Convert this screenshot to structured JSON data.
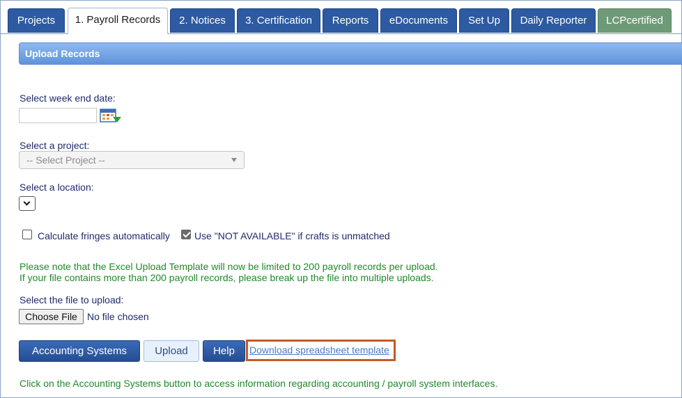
{
  "tabs": [
    {
      "label": "Projects"
    },
    {
      "label": "1. Payroll Records",
      "active": true
    },
    {
      "label": "2. Notices"
    },
    {
      "label": "3. Certification"
    },
    {
      "label": "Reports"
    },
    {
      "label": "eDocuments"
    },
    {
      "label": "Set Up"
    },
    {
      "label": "Daily Reporter"
    },
    {
      "label": "LCPcertified"
    }
  ],
  "panel": {
    "title": "Upload Records"
  },
  "form": {
    "week_end_label": "Select week end date:",
    "week_end_value": "",
    "project_label": "Select a project:",
    "project_selected": "-- Select Project --",
    "location_label": "Select a location:",
    "location_selected": "",
    "calc_fringes": {
      "label": "Calculate fringes automatically",
      "checked": false
    },
    "not_available": {
      "label": "Use \"NOT AVAILABLE\" if crafts is unmatched",
      "checked": true
    },
    "notice_line1": "Please note that the Excel Upload Template will now be limited to 200 payroll records per upload.",
    "notice_line2": "If your file contains more than 200 payroll records, please break up the file into multiple uploads.",
    "file_label": "Select the file to upload:",
    "choose_file": "Choose File",
    "file_status": "No file chosen"
  },
  "buttons": {
    "accounting": "Accounting Systems",
    "upload": "Upload",
    "help": "Help",
    "download_template": "Download spreadsheet template"
  },
  "footer": {
    "note": "Click on the Accounting Systems button to access information regarding accounting / payroll system interfaces."
  },
  "colors": {
    "tab_blue": "#2d5aa0",
    "tab_green": "#6f9a78",
    "notice_green": "#1e8a2a",
    "highlight_orange": "#c55a24",
    "link_blue": "#4a78c8"
  }
}
